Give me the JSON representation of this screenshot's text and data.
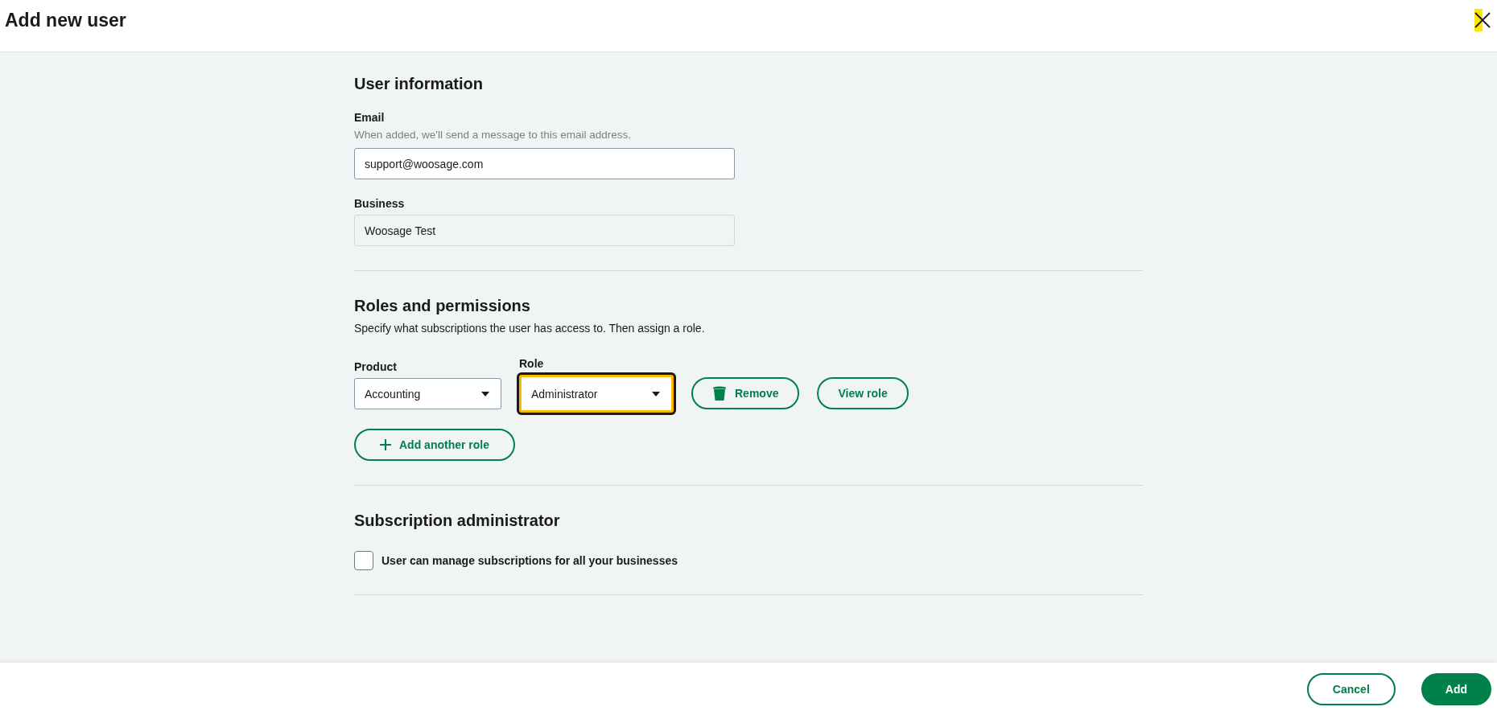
{
  "header": {
    "title": "Add new user",
    "close_focused": true
  },
  "user_information": {
    "heading": "User information",
    "email": {
      "label": "Email",
      "hint": "When added, we'll send a message to this email address.",
      "value": "support@woosage.com"
    },
    "business": {
      "label": "Business",
      "value": "Woosage Test",
      "disabled": true
    }
  },
  "roles": {
    "heading": "Roles and permissions",
    "description": "Specify what subscriptions the user has access to. Then assign a role.",
    "selects": [
      {
        "label": "Product",
        "value": "Accounting",
        "focused": false
      },
      {
        "label": "Role",
        "value": "Administrator",
        "focused": true
      }
    ],
    "actions": [
      {
        "label": "Remove",
        "kind": "remove"
      },
      {
        "label": "View role",
        "kind": "plain"
      }
    ],
    "add_button": "Add another role"
  },
  "subscription_administrator": {
    "heading": "Subscription administrator",
    "checkbox": {
      "label": "User can manage subscriptions for all your businesses",
      "checked": false
    }
  },
  "footer": {
    "buttons": [
      {
        "label": "Cancel",
        "kind": "secondary"
      },
      {
        "label": "Add",
        "kind": "primary"
      }
    ]
  }
}
